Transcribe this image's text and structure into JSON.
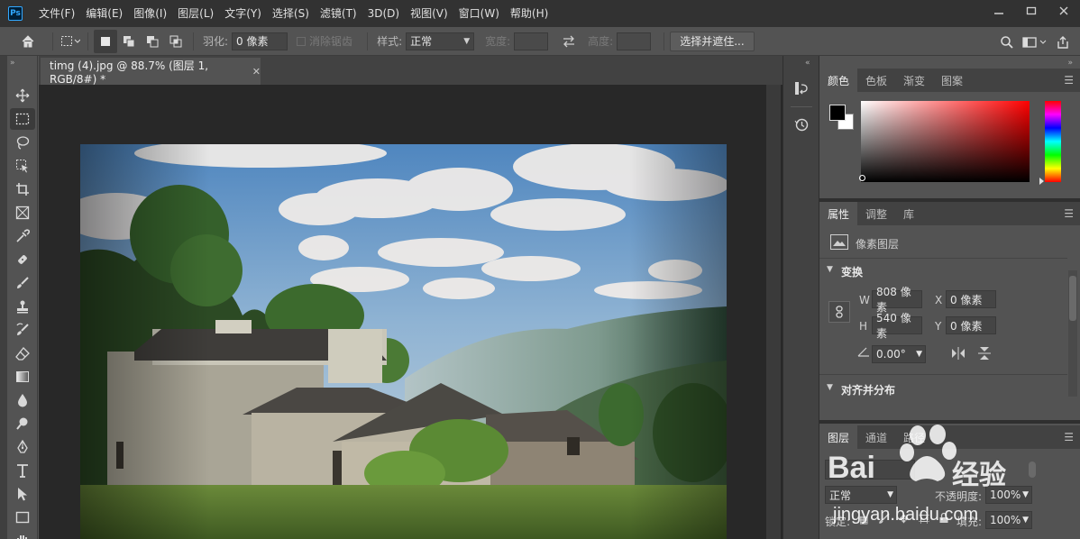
{
  "app": {
    "logo": "Ps"
  },
  "menu": [
    "文件(F)",
    "编辑(E)",
    "图像(I)",
    "图层(L)",
    "文字(Y)",
    "选择(S)",
    "滤镜(T)",
    "3D(D)",
    "视图(V)",
    "窗口(W)",
    "帮助(H)"
  ],
  "options": {
    "feather_label": "羽化:",
    "feather_value": "0 像素",
    "antialias_label": "消除锯齿",
    "style_label": "样式:",
    "style_value": "正常",
    "width_label": "宽度:",
    "height_label": "高度:",
    "select_mask_label": "选择并遮住..."
  },
  "document": {
    "tab_title": "timg (4).jpg @ 88.7% (图层 1, RGB/8#) *"
  },
  "color_panel": {
    "tabs": [
      "颜色",
      "色板",
      "渐变",
      "图案"
    ],
    "foreground": "#000000",
    "background": "#ffffff"
  },
  "properties_panel": {
    "tabs": [
      "属性",
      "调整",
      "库"
    ],
    "layer_type": "像素图层",
    "transform_title": "变换",
    "w_label": "W",
    "w_value": "808 像素",
    "x_label": "X",
    "x_value": "0 像素",
    "h_label": "H",
    "h_value": "540 像素",
    "y_label": "Y",
    "y_value": "0 像素",
    "angle_value": "0.00°",
    "align_title": "对齐并分布"
  },
  "layers_panel": {
    "tabs": [
      "图层",
      "通道",
      "路径"
    ],
    "blend_mode": "正常",
    "opacity_label": "不透明度:",
    "opacity_value": "100%",
    "lock_label": "锁定:",
    "fill_label": "填充:",
    "fill_value": "100%"
  },
  "watermark": {
    "brand": "Bai",
    "brand2": "经验",
    "url": "jingyan.baidu.com"
  }
}
